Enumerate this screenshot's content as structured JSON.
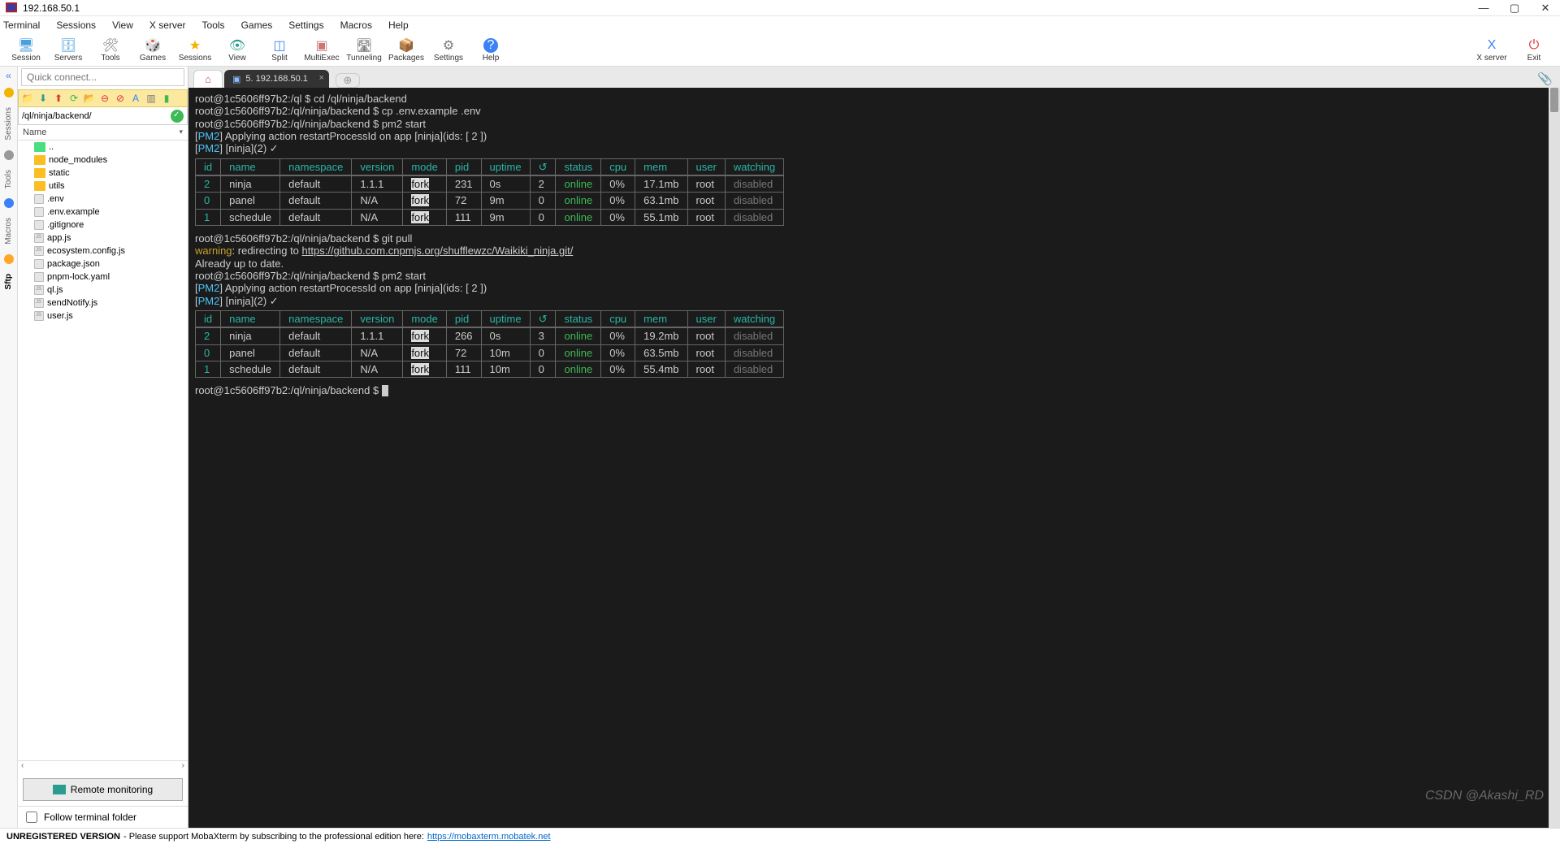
{
  "window": {
    "title": "192.168.50.1"
  },
  "menubar": [
    "Terminal",
    "Sessions",
    "View",
    "X server",
    "Tools",
    "Games",
    "Settings",
    "Macros",
    "Help"
  ],
  "toolbar": [
    {
      "label": "Session",
      "icon": "🖥",
      "color": "#4b9fde"
    },
    {
      "label": "Servers",
      "icon": "🗄",
      "color": "#4b9fde"
    },
    {
      "label": "Tools",
      "icon": "🛠",
      "color": "#7a7a7a"
    },
    {
      "label": "Games",
      "icon": "🎲",
      "color": "#c77"
    },
    {
      "label": "Sessions",
      "icon": "★",
      "color": "#f2b200"
    },
    {
      "label": "View",
      "icon": "👁",
      "color": "#2a9d8f"
    },
    {
      "label": "Split",
      "icon": "◫",
      "color": "#3b82f6"
    },
    {
      "label": "MultiExec",
      "icon": "▣",
      "color": "#c77"
    },
    {
      "label": "Tunneling",
      "icon": "🛣",
      "color": "#7a7a7a"
    },
    {
      "label": "Packages",
      "icon": "📦",
      "color": "#b28444"
    },
    {
      "label": "Settings",
      "icon": "⚙",
      "color": "#7a7a7a"
    },
    {
      "label": "Help",
      "icon": "?",
      "color": "#fff",
      "bg": "#3b82f6"
    }
  ],
  "toolbar_right": [
    {
      "label": "X server",
      "icon": "X",
      "color": "#3b82f6"
    },
    {
      "label": "Exit",
      "icon": "⏻",
      "color": "#d33"
    }
  ],
  "sidebar": {
    "quick_placeholder": "Quick connect...",
    "path": "/ql/ninja/backend/",
    "name_header": "Name",
    "tree": [
      {
        "type": "folder-green",
        "name": ".."
      },
      {
        "type": "folder",
        "name": "node_modules"
      },
      {
        "type": "folder",
        "name": "static"
      },
      {
        "type": "folder",
        "name": "utils"
      },
      {
        "type": "file",
        "name": ".env"
      },
      {
        "type": "file",
        "name": ".env.example"
      },
      {
        "type": "file",
        "name": ".gitignore"
      },
      {
        "type": "file-js",
        "name": "app.js"
      },
      {
        "type": "file-js",
        "name": "ecosystem.config.js"
      },
      {
        "type": "file",
        "name": "package.json"
      },
      {
        "type": "file",
        "name": "pnpm-lock.yaml"
      },
      {
        "type": "file-js",
        "name": "ql.js"
      },
      {
        "type": "file-js",
        "name": "sendNotify.js"
      },
      {
        "type": "file-js",
        "name": "user.js"
      }
    ],
    "remote_btn": "Remote monitoring",
    "follow_label": "Follow terminal folder",
    "ribbons": [
      "Sessions",
      "Tools",
      "Macros",
      "Sftp"
    ]
  },
  "tabs": {
    "active_label": "5. 192.168.50.1"
  },
  "terminal": {
    "prompt_host": "root@1c5606ff97b2",
    "cwd": "/ql/ninja/backend",
    "lines_pre": [
      {
        "prompt": true,
        "path": "/ql",
        "cmd": "cd /ql/ninja/backend"
      },
      {
        "prompt": true,
        "path": "/ql/ninja/backend",
        "cmd": "cp .env.example .env"
      },
      {
        "prompt": true,
        "path": "/ql/ninja/backend",
        "cmd": "pm2 start"
      }
    ],
    "pm2_action": "Applying action restartProcessId on app [ninja](ids: [ 2 ])",
    "pm2_done": "[ninja](2) ✓",
    "headers": [
      "id",
      "name",
      "namespace",
      "version",
      "mode",
      "pid",
      "uptime",
      "↺",
      "status",
      "cpu",
      "mem",
      "user",
      "watching"
    ],
    "rows1": [
      [
        "2",
        "ninja",
        "default",
        "1.1.1",
        "fork",
        "231",
        "0s",
        "2",
        "online",
        "0%",
        "17.1mb",
        "root",
        "disabled"
      ],
      [
        "0",
        "panel",
        "default",
        "N/A",
        "fork",
        "72",
        "9m",
        "0",
        "online",
        "0%",
        "63.1mb",
        "root",
        "disabled"
      ],
      [
        "1",
        "schedule",
        "default",
        "N/A",
        "fork",
        "111",
        "9m",
        "0",
        "online",
        "0%",
        "55.1mb",
        "root",
        "disabled"
      ]
    ],
    "git_cmd": "git pull",
    "warning_label": "warning",
    "warning_text": ": redirecting to ",
    "warning_url": "https://github.com.cnpmjs.org/shufflewzc/Waikiki_ninja.git/",
    "already": "Already up to date.",
    "pm2_cmd": "pm2 start",
    "rows2": [
      [
        "2",
        "ninja",
        "default",
        "1.1.1",
        "fork",
        "266",
        "0s",
        "3",
        "online",
        "0%",
        "19.2mb",
        "root",
        "disabled"
      ],
      [
        "0",
        "panel",
        "default",
        "N/A",
        "fork",
        "72",
        "10m",
        "0",
        "online",
        "0%",
        "63.5mb",
        "root",
        "disabled"
      ],
      [
        "1",
        "schedule",
        "default",
        "N/A",
        "fork",
        "111",
        "10m",
        "0",
        "online",
        "0%",
        "55.4mb",
        "root",
        "disabled"
      ]
    ]
  },
  "statusbar": {
    "unreg": "UNREGISTERED VERSION",
    "msg": "  -   Please support MobaXterm by subscribing to the professional edition here:  ",
    "url": "https://mobaxterm.mobatek.net"
  },
  "watermark": "CSDN @Akashi_RD"
}
